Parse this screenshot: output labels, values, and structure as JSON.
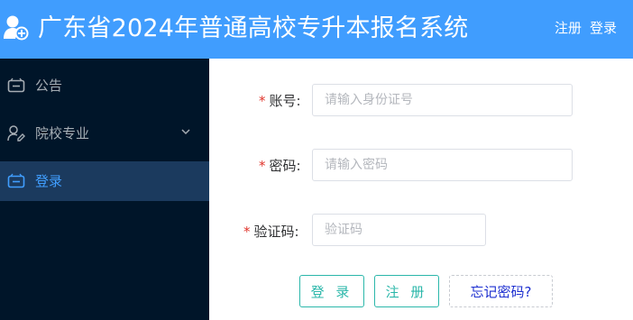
{
  "header": {
    "title": "广东省2024年普通高校专升本报名系统",
    "register_link": "注册",
    "login_link": "登录",
    "background_color": "#409dfe"
  },
  "sidebar": {
    "background_color": "#001529",
    "items": [
      {
        "label": "公告",
        "icon": "notice-icon",
        "active": false
      },
      {
        "label": "院校专业",
        "icon": "edit-user-icon",
        "active": false,
        "has_submenu": true
      },
      {
        "label": "登录",
        "icon": "login-icon",
        "active": true
      }
    ]
  },
  "form": {
    "account": {
      "label": "账号:",
      "placeholder": "请输入身份证号",
      "value": ""
    },
    "password": {
      "label": "密码:",
      "placeholder": "请输入密码",
      "value": ""
    },
    "captcha": {
      "label": "验证码:",
      "placeholder": "验证码",
      "value": ""
    },
    "required_mark": "*"
  },
  "buttons": {
    "login": "登 录",
    "register": "注 册",
    "forgot": "忘记密码?"
  },
  "colors": {
    "accent": "#409eff",
    "button_border": "#2bb7aa",
    "required": "#e0352c"
  }
}
